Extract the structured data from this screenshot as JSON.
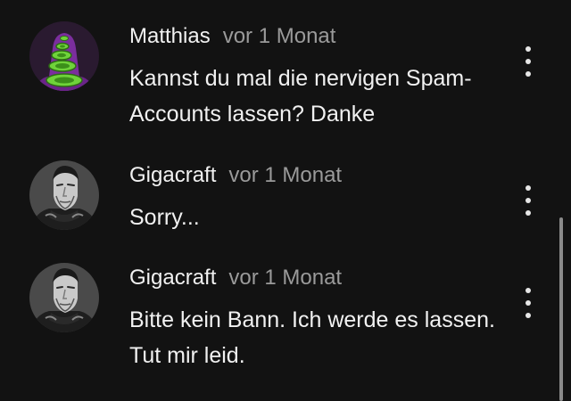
{
  "comments": [
    {
      "author": "Matthias",
      "time": "vor 1 Monat",
      "text": "Kannst du mal die nervigen Spam-Accounts lassen? Danke",
      "avatar_icon": "purple-tentacle-avatar"
    },
    {
      "author": "Gigacraft",
      "time": "vor 1 Monat",
      "text": "Sorry...",
      "avatar_icon": "gigachad-avatar"
    },
    {
      "author": "Gigacraft",
      "time": "vor 1 Monat",
      "text": "Bitte kein Bann. Ich werde es lassen. Tut mir leid.",
      "avatar_icon": "gigachad-avatar"
    }
  ],
  "menu_icon": "more-vertical-icon",
  "colors": {
    "background": "#121212",
    "text": "#f1f1f1",
    "secondary_text": "#9a9a9a",
    "tentacle_purple": "#7b2e9e",
    "tentacle_green": "#6fd33a"
  }
}
